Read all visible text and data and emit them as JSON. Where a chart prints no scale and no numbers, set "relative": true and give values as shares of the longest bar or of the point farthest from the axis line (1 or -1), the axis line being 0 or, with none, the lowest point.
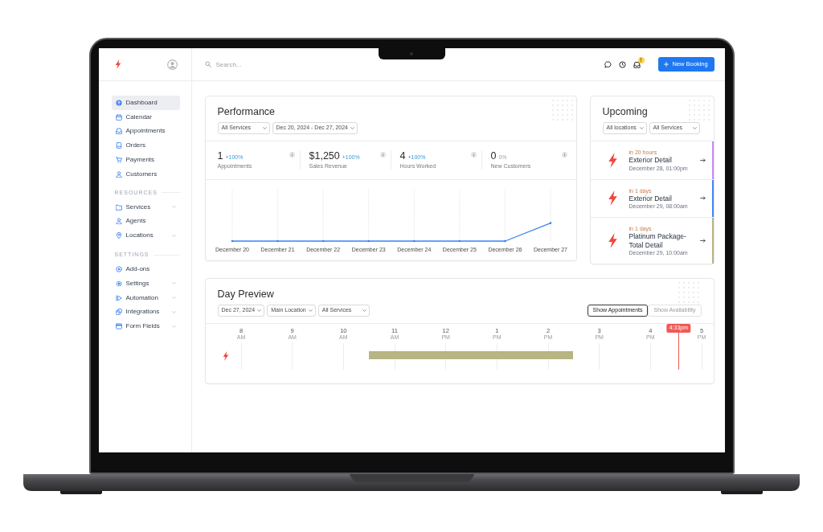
{
  "sidebar": {
    "items": [
      {
        "label": "Dashboard",
        "selected": true,
        "expandable": false
      },
      {
        "label": "Calendar",
        "selected": false,
        "expandable": false
      },
      {
        "label": "Appointments",
        "selected": false,
        "expandable": false
      },
      {
        "label": "Orders",
        "selected": false,
        "expandable": false
      },
      {
        "label": "Payments",
        "selected": false,
        "expandable": false
      },
      {
        "label": "Customers",
        "selected": false,
        "expandable": false
      }
    ],
    "sections": [
      {
        "title": "RESOURCES",
        "items": [
          {
            "label": "Services",
            "selected": false,
            "expandable": true
          },
          {
            "label": "Agents",
            "selected": false,
            "expandable": false
          },
          {
            "label": "Locations",
            "selected": false,
            "expandable": true
          }
        ]
      },
      {
        "title": "SETTINGS",
        "items": [
          {
            "label": "Add-ons",
            "selected": false,
            "expandable": false
          },
          {
            "label": "Settings",
            "selected": false,
            "expandable": true
          },
          {
            "label": "Automation",
            "selected": false,
            "expandable": true
          },
          {
            "label": "Integrations",
            "selected": false,
            "expandable": true
          },
          {
            "label": "Form Fields",
            "selected": false,
            "expandable": true
          }
        ]
      }
    ]
  },
  "top_bar": {
    "search": {
      "placeholder": "Search..."
    },
    "notification_badge": "!",
    "new_booking_button": "New Booking"
  },
  "performance": {
    "title": "Performance",
    "filters": [
      {
        "value": "All Services"
      },
      {
        "value": "Dec 20, 2024 - Dec 27, 2024"
      }
    ],
    "stats": [
      {
        "value": "1",
        "change": "+100%",
        "positive": true,
        "label": "Appointments"
      },
      {
        "value": "$1,250",
        "change": "+100%",
        "positive": true,
        "label": "Sales Revenue"
      },
      {
        "value": "4",
        "change": "+100%",
        "positive": true,
        "label": "Hours Worked"
      },
      {
        "value": "0",
        "change": "0%",
        "positive": false,
        "label": "New Customers"
      }
    ],
    "chart_data": {
      "type": "line",
      "relative": true,
      "grid": true,
      "categories": [
        "December 20",
        "December 21",
        "December 22",
        "December 23",
        "December 24",
        "December 25",
        "December 26",
        "December 27"
      ],
      "series": [
        {
          "color": "#3b82f6",
          "values": [
            0,
            0,
            0,
            0,
            0,
            0,
            0,
            1
          ]
        }
      ]
    }
  },
  "upcoming": {
    "title": "Upcoming",
    "filters": [
      {
        "value": "All locations"
      },
      {
        "value": "All Services"
      }
    ],
    "items": [
      {
        "relative_time": "in 20 hours",
        "title": "Exterior Detail",
        "date": "December 28, 01:00pm",
        "color": "#c58af9"
      },
      {
        "relative_time": "in 1 days",
        "title": "Exterior Detail",
        "date": "December 29, 08:00am",
        "color": "#4285f4"
      },
      {
        "relative_time": "in 1 days",
        "title": "Platinum Package-Total Detail",
        "date": "December 29, 10:00am",
        "color": "#b8b483"
      }
    ]
  },
  "day_preview": {
    "title": "Day Preview",
    "filters": [
      {
        "value": "Dec 27, 2024"
      },
      {
        "value": "Main Location"
      },
      {
        "value": "All Services"
      }
    ],
    "view_toggle": [
      {
        "label": "Show Appointments",
        "selected": true
      },
      {
        "label": "Show Availability",
        "selected": false
      }
    ],
    "timeline": {
      "hours": [
        {
          "hour": "8",
          "period": "AM"
        },
        {
          "hour": "9",
          "period": "AM"
        },
        {
          "hour": "10",
          "period": "AM"
        },
        {
          "hour": "11",
          "period": "AM"
        },
        {
          "hour": "12",
          "period": "PM"
        },
        {
          "hour": "1",
          "period": "PM"
        },
        {
          "hour": "2",
          "period": "PM"
        },
        {
          "hour": "3",
          "period": "PM"
        },
        {
          "hour": "4",
          "period": "PM"
        },
        {
          "hour": "5",
          "period": "PM"
        }
      ],
      "current_time": "4:33pm",
      "events": [
        {
          "color": "#b8b483"
        }
      ]
    }
  }
}
